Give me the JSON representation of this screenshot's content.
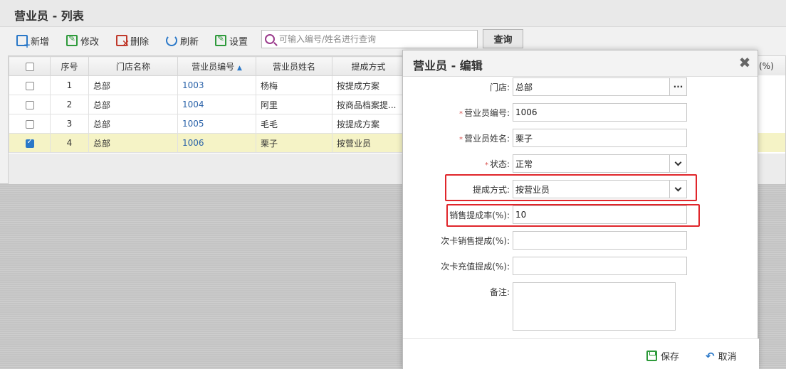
{
  "list": {
    "title": "营业员 - 列表",
    "toolbar": {
      "new_label": "新增",
      "edit_label": "修改",
      "delete_label": "删除",
      "refresh_label": "刷新",
      "settings_label": "设置",
      "search_placeholder": "可输入编号/姓名进行查询",
      "query_label": "查询"
    },
    "columns": {
      "seq": "序号",
      "store": "门店名称",
      "code": "营业员编号",
      "name": "营业员姓名",
      "method": "提成方式",
      "right_partial": "(%)"
    },
    "rows": [
      {
        "seq": "1",
        "store": "总部",
        "code": "1003",
        "name": "杨梅",
        "method": "按提成方案",
        "checked": false
      },
      {
        "seq": "2",
        "store": "总部",
        "code": "1004",
        "name": "阿里",
        "method": "按商品档案提...",
        "checked": false
      },
      {
        "seq": "3",
        "store": "总部",
        "code": "1005",
        "name": "毛毛",
        "method": "按提成方案",
        "checked": false
      },
      {
        "seq": "4",
        "store": "总部",
        "code": "1006",
        "name": "栗子",
        "method": "按营业员",
        "checked": true
      }
    ]
  },
  "dialog": {
    "title": "营业员 - 编辑",
    "fields": {
      "store_label": "门店:",
      "store_value": "总部",
      "code_label": "营业员编号:",
      "code_value": "1006",
      "name_label": "营业员姓名:",
      "name_value": "栗子",
      "status_label": "状态:",
      "status_value": "正常",
      "method_label": "提成方式:",
      "method_value": "按营业员",
      "rate_label": "销售提成率(%):",
      "rate_value": "10",
      "card_sale_label": "次卡销售提成(%):",
      "card_sale_value": "",
      "card_recharge_label": "次卡充值提成(%):",
      "card_recharge_value": "",
      "remark_label": "备注:",
      "remark_value": ""
    },
    "required_mark": "*",
    "save_label": "保存",
    "cancel_label": "取消"
  },
  "colors": {
    "highlight": "#e0262b",
    "link": "#2b63a9",
    "selected_row": "#f5f3c6"
  }
}
